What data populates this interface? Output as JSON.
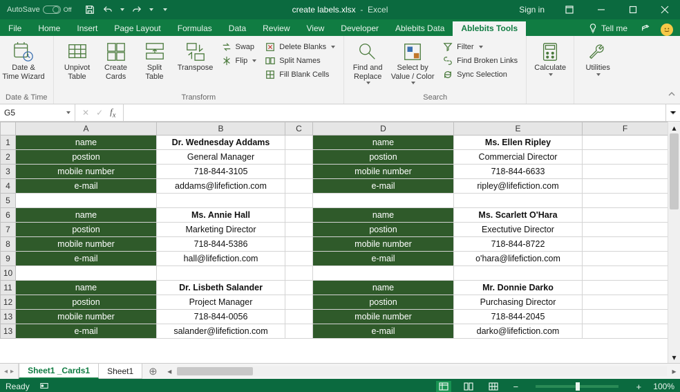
{
  "titlebar": {
    "autosave_label": "AutoSave",
    "autosave_state": "Off",
    "filename": "create labels.xlsx",
    "app": "Excel",
    "signin": "Sign in"
  },
  "tabs": {
    "items": [
      "File",
      "Home",
      "Insert",
      "Page Layout",
      "Formulas",
      "Data",
      "Review",
      "View",
      "Developer",
      "Ablebits Data",
      "Ablebits Tools"
    ],
    "active": "Ablebits Tools",
    "tellme": "Tell me"
  },
  "ribbon": {
    "group_datetime": {
      "label": "Date & Time",
      "btn": "Date &\nTime Wizard"
    },
    "group_transform": {
      "label": "Transform",
      "big": [
        "Unpivot\nTable",
        "Create\nCards",
        "Split\nTable",
        "Transpose"
      ],
      "small": [
        "Swap",
        "Flip",
        "Delete Blanks",
        "Split Names",
        "Fill Blank Cells"
      ]
    },
    "group_search": {
      "label": "Search",
      "big": [
        "Find and\nReplace",
        "Select by\nValue / Color"
      ],
      "small": [
        "Filter",
        "Find Broken Links",
        "Sync Selection"
      ]
    },
    "group_calc": {
      "btn": "Calculate"
    },
    "group_util": {
      "btn": "Utilities"
    }
  },
  "namebox": "G5",
  "columns": [
    "A",
    "B",
    "C",
    "D",
    "E",
    "F"
  ],
  "rows": [
    "1",
    "2",
    "3",
    "4",
    "5",
    "6",
    "7",
    "8",
    "9",
    "10",
    "11",
    "12",
    "13"
  ],
  "cards": {
    "labels": [
      "name",
      "postion",
      "mobile number",
      "e-mail"
    ],
    "r1c1": [
      "Dr. Wednesday Addams",
      "General Manager",
      "718-844-3105",
      "addams@lifefiction.com"
    ],
    "r1c2": [
      "Ms. Ellen Ripley",
      "Commercial Director",
      "718-844-6633",
      "ripley@lifefiction.com"
    ],
    "r2c1": [
      "Ms. Annie Hall",
      "Marketing Director",
      "718-844-5386",
      "hall@lifefiction.com"
    ],
    "r2c2": [
      "Ms. Scarlett O'Hara",
      "Exectutive Director",
      "718-844-8722",
      "o'hara@lifefiction.com"
    ],
    "r3c1": [
      "Dr. Lisbeth Salander",
      "Project Manager",
      "718-844-0056",
      "salander@lifefiction.com"
    ],
    "r3c2": [
      "Mr. Donnie Darko",
      "Purchasing Director",
      "718-844-2045",
      "darko@lifefiction.com"
    ]
  },
  "sheet_tabs": {
    "items": [
      "Sheet1 _Cards1",
      "Sheet1"
    ],
    "active": "Sheet1 _Cards1"
  },
  "status": {
    "ready": "Ready",
    "zoom": "100%"
  }
}
